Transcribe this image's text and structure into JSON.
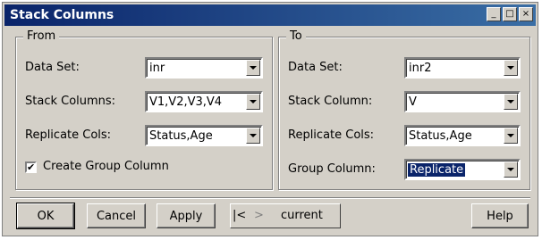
{
  "window": {
    "title": "Stack Columns"
  },
  "from": {
    "legend": "From",
    "data_set_label": "Data Set:",
    "data_set_value": "inr",
    "stack_columns_label": "Stack Columns:",
    "stack_columns_value": "V1,V2,V3,V4",
    "replicate_cols_label": "Replicate Cols:",
    "replicate_cols_value": "Status,Age",
    "create_group_label": "Create Group Column",
    "create_group_checked": true,
    "check_mark": "✔"
  },
  "to": {
    "legend": "To",
    "data_set_label": "Data Set:",
    "data_set_value": "inr2",
    "stack_column_label": "Stack Column:",
    "stack_column_value": "V",
    "replicate_cols_label": "Replicate Cols:",
    "replicate_cols_value": "Status,Age",
    "group_column_label": "Group Column:",
    "group_column_value": "Replicate"
  },
  "buttons": {
    "ok": "OK",
    "cancel": "Cancel",
    "apply": "Apply",
    "nav_first": "|<",
    "nav_next": ">",
    "current": "current",
    "help": "Help"
  },
  "title_buttons": {
    "minimize": "_",
    "maximize": "□",
    "close": "×"
  }
}
